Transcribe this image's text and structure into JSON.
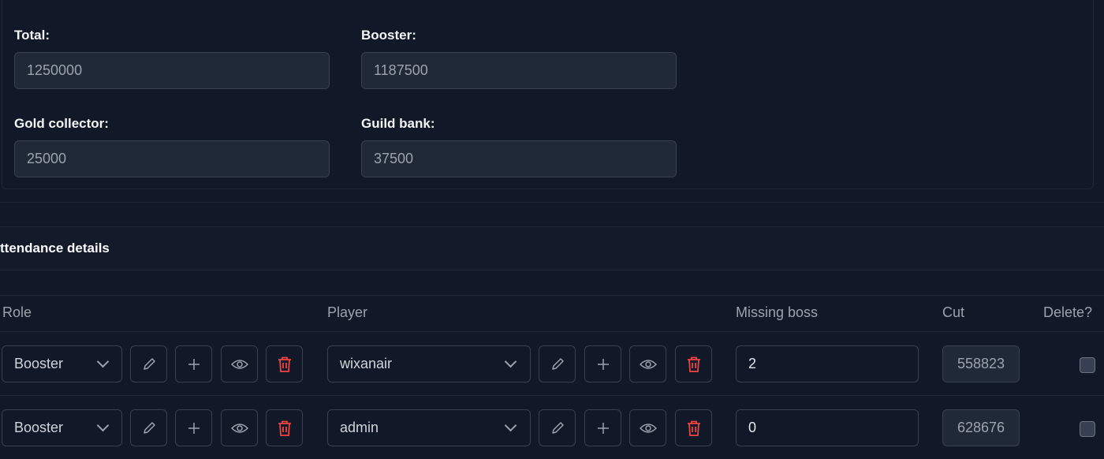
{
  "summary": {
    "total": {
      "label": "Total:",
      "value": "1250000"
    },
    "booster": {
      "label": "Booster:",
      "value": "1187500"
    },
    "gold_collector": {
      "label": "Gold collector:",
      "value": "25000"
    },
    "guild_bank": {
      "label": "Guild bank:",
      "value": "37500"
    }
  },
  "attendance": {
    "title": "ttendance details",
    "columns": {
      "role": "Role",
      "player": "Player",
      "missing_boss": "Missing boss",
      "cut": "Cut",
      "delete": "Delete?"
    },
    "rows": [
      {
        "role": "Booster",
        "player": "wixanair",
        "missing_boss": "2",
        "cut": "558823"
      },
      {
        "role": "Booster",
        "player": "admin",
        "missing_boss": "0",
        "cut": "628676"
      }
    ]
  },
  "colors": {
    "background": "#111827",
    "danger": "#ef4444",
    "border": "#374151"
  },
  "icons": [
    "chevron-down-icon",
    "pencil-icon",
    "plus-icon",
    "eye-icon",
    "trash-icon"
  ]
}
